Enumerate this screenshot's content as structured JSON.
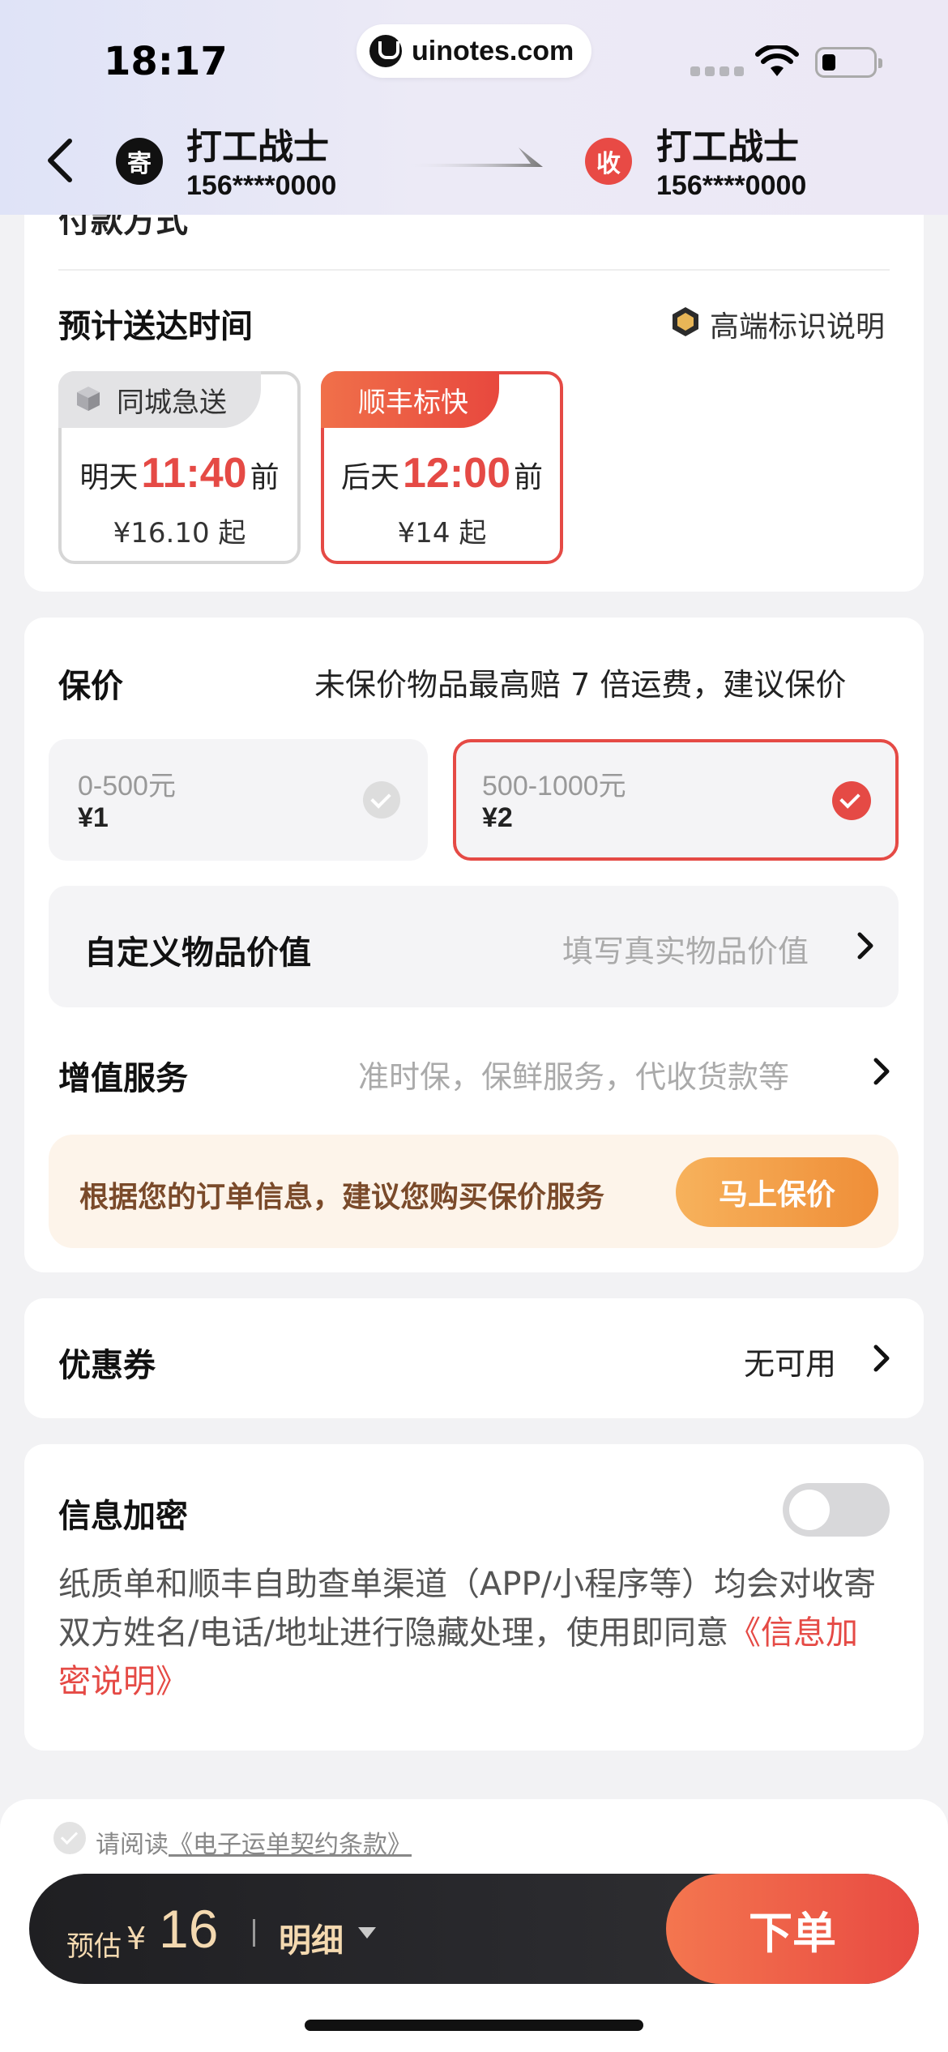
{
  "status": {
    "time": "18:17",
    "url": "uinotes.com"
  },
  "header": {
    "sender_badge": "寄",
    "sender_name": "打工战士",
    "sender_phone": "156****0000",
    "receiver_badge": "收",
    "receiver_name": "打工战士",
    "receiver_phone": "156****0000"
  },
  "delivery": {
    "cut_text": "付款方式",
    "title": "预计送达时间",
    "legend_label": "高端标识说明",
    "options": [
      {
        "tag": "同城急送",
        "day": "明天",
        "time": "11:40",
        "suffix": "前",
        "price": "¥16.10 起"
      },
      {
        "tag": "顺丰标快",
        "day": "后天",
        "time": "12:00",
        "suffix": "前",
        "price": "¥14 起"
      }
    ]
  },
  "insurance": {
    "title": "保价",
    "note": "未保价物品最高赔 7 倍运费，建议保价",
    "options": [
      {
        "range": "0-500元",
        "price": "¥1"
      },
      {
        "range": "500-1000元",
        "price": "¥2"
      }
    ],
    "custom_label": "自定义物品价值",
    "custom_placeholder": "填写真实物品价值"
  },
  "value_added": {
    "title": "增值服务",
    "hint": "准时保，保鲜服务，代收货款等"
  },
  "promo": {
    "text": "根据您的订单信息，建议您购买保价服务",
    "button": "马上保价"
  },
  "coupon": {
    "title": "优惠券",
    "value": "无可用"
  },
  "encryption": {
    "title": "信息加密",
    "toggle_on": false,
    "description": "纸质单和顺丰自助查单渠道（APP/小程序等）均会对收寄双方姓名/电话/地址进行隐藏处理，使用即同意",
    "link": "《信息加密说明》"
  },
  "footer": {
    "agree_prefix": "请阅读",
    "agree_link": "《电子运单契约条款》",
    "estimate_label": "预估",
    "currency": "¥",
    "estimate_value": "16",
    "detail_label": "明细",
    "submit_label": "下单"
  },
  "colors": {
    "accent": "#e54a45",
    "promo_bg": "#fdf4ea",
    "promo_btn": "#ef8e38",
    "bar_bg": "#1f1f22"
  }
}
